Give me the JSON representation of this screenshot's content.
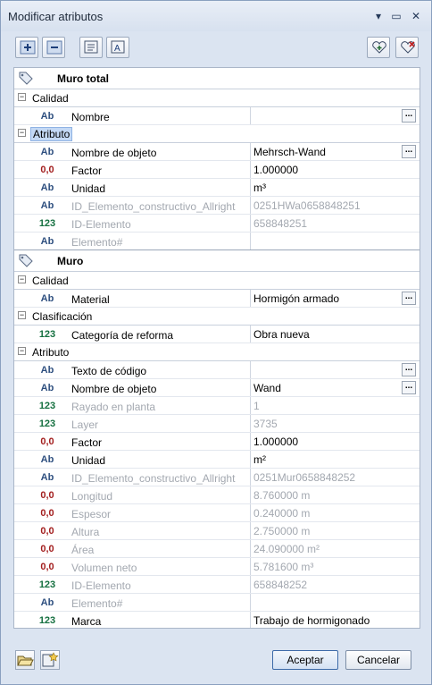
{
  "window": {
    "title": "Modificar atributos"
  },
  "icons": {
    "minimize": "minimize-icon",
    "restore": "restore-icon",
    "close": "close-icon"
  },
  "objects": [
    {
      "title": "Muro total",
      "groups": [
        {
          "label": "Calidad",
          "selected": false,
          "rows": [
            {
              "type": "Ab",
              "name": "Nombre",
              "value": "",
              "dots": true,
              "disabled": false
            }
          ]
        },
        {
          "label": "Atributo",
          "selected": true,
          "rows": [
            {
              "type": "Ab",
              "name": "Nombre de objeto",
              "value": "Mehrsch-Wand",
              "dots": true,
              "disabled": false
            },
            {
              "type": "0,0",
              "name": "Factor",
              "value": "1.000000",
              "dots": false,
              "disabled": false
            },
            {
              "type": "Ab",
              "name": "Unidad",
              "value": "m³",
              "dots": false,
              "disabled": false
            },
            {
              "type": "Ab",
              "name": "ID_Elemento_constructivo_Allright",
              "value": "0251HWa0658848251",
              "dots": false,
              "disabled": true
            },
            {
              "type": "123",
              "name": "ID-Elemento",
              "value": "658848251",
              "dots": false,
              "disabled": true
            },
            {
              "type": "Ab",
              "name": "Elemento#",
              "value": "",
              "dots": false,
              "disabled": true
            }
          ]
        }
      ]
    },
    {
      "title": "Muro",
      "groups": [
        {
          "label": "Calidad",
          "selected": false,
          "rows": [
            {
              "type": "Ab",
              "name": "Material",
              "value": "Hormigón armado",
              "dots": true,
              "disabled": false
            }
          ]
        },
        {
          "label": "Clasificación",
          "selected": false,
          "rows": [
            {
              "type": "123",
              "name": "Categoría de reforma",
              "value": "Obra nueva",
              "dots": false,
              "disabled": false
            }
          ]
        },
        {
          "label": "Atributo",
          "selected": false,
          "rows": [
            {
              "type": "Ab",
              "name": "Texto de código",
              "value": "",
              "dots": true,
              "disabled": false
            },
            {
              "type": "Ab",
              "name": "Nombre de objeto",
              "value": "Wand",
              "dots": true,
              "disabled": false
            },
            {
              "type": "123",
              "name": "Rayado en planta",
              "value": "1",
              "dots": false,
              "disabled": true
            },
            {
              "type": "123",
              "name": "Layer",
              "value": "3735",
              "dots": false,
              "disabled": true
            },
            {
              "type": "0,0",
              "name": "Factor",
              "value": "1.000000",
              "dots": false,
              "disabled": false
            },
            {
              "type": "Ab",
              "name": "Unidad",
              "value": "m²",
              "dots": false,
              "disabled": false
            },
            {
              "type": "Ab",
              "name": "ID_Elemento_constructivo_Allright",
              "value": "0251Mur0658848252",
              "dots": false,
              "disabled": true
            },
            {
              "type": "0,0",
              "name": "Longitud",
              "value": "8.760000 m",
              "dots": false,
              "disabled": true
            },
            {
              "type": "0,0",
              "name": "Espesor",
              "value": "0.240000 m",
              "dots": false,
              "disabled": true
            },
            {
              "type": "0,0",
              "name": "Altura",
              "value": "2.750000 m",
              "dots": false,
              "disabled": true
            },
            {
              "type": "0,0",
              "name": "Área",
              "value": "24.090000 m²",
              "dots": false,
              "disabled": true
            },
            {
              "type": "0,0",
              "name": "Volumen neto",
              "value": "5.781600 m³",
              "dots": false,
              "disabled": true
            },
            {
              "type": "123",
              "name": "ID-Elemento",
              "value": "658848252",
              "dots": false,
              "disabled": true
            },
            {
              "type": "Ab",
              "name": "Elemento#",
              "value": "",
              "dots": false,
              "disabled": true
            },
            {
              "type": "123",
              "name": "Marca",
              "value": "Trabajo de hormigonado",
              "dots": false,
              "disabled": false
            }
          ]
        }
      ]
    }
  ],
  "buttons": {
    "accept": "Aceptar",
    "cancel": "Cancelar",
    "dots": "..."
  },
  "colors": {
    "type_text": "#2e4f7f",
    "type_number": "#a31f1f",
    "type_integer": "#157040",
    "disabled": "#a3a8b0"
  }
}
